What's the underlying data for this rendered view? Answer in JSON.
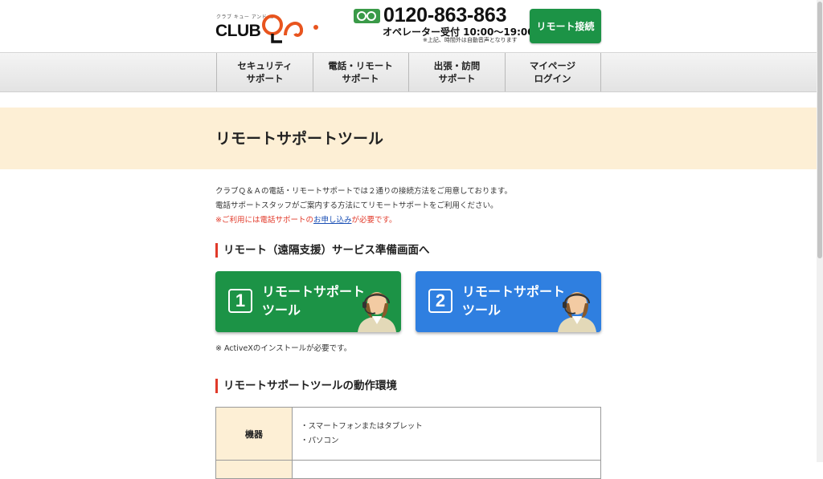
{
  "header": {
    "logo_tagline": "クラブ キュー アンド エー",
    "logo_text": "CLUB",
    "freedial_icon": "freedial-icon",
    "phone_number": "0120-863-863",
    "phone_hours": "オペレーター受付 10:00〜19:00",
    "phone_note": "※上記、時間外は自動音声となります",
    "remote_button": "リモート接続"
  },
  "nav": {
    "items": [
      {
        "line1": "セキュリティ",
        "line2": "サポート"
      },
      {
        "line1": "電話・リモート",
        "line2": "サポート"
      },
      {
        "line1": "出張・訪問",
        "line2": "サポート"
      },
      {
        "line1": "マイページ",
        "line2": "ログイン"
      }
    ]
  },
  "page": {
    "title": "リモートサポートツール",
    "intro_line1": "クラブＱ＆Ａの電話・リモートサポートでは２通りの接続方法をご用意しております。",
    "intro_line2": "電話サポートスタッフがご案内する方法にてリモートサポートをご利用ください。",
    "notice_prefix": "※ご利用には電話サポートの",
    "notice_link": "お申し込み",
    "notice_suffix": "が必要です。",
    "section1_heading": "リモート（遠隔支援）サービス準備画面へ",
    "tools": [
      {
        "number": "1",
        "line1": "リモートサポート",
        "line2": "ツール",
        "color": "#1c9346"
      },
      {
        "number": "2",
        "line1": "リモートサポート",
        "line2": "ツール",
        "color": "#2f7fe0"
      }
    ],
    "activex_note": "※ ActiveXのインストールが必要です。",
    "section2_heading": "リモートサポートツールの動作環境",
    "env_table": {
      "rows": [
        {
          "header": "機器",
          "items": [
            "・スマートフォンまたはタブレット",
            "・パソコン"
          ]
        }
      ]
    }
  },
  "colors": {
    "accent_green": "#1c9346",
    "accent_blue": "#2f7fe0",
    "banner_bg": "#fdefd5",
    "heading_bar": "#e03a2a",
    "logo_orange": "#e8541e"
  }
}
